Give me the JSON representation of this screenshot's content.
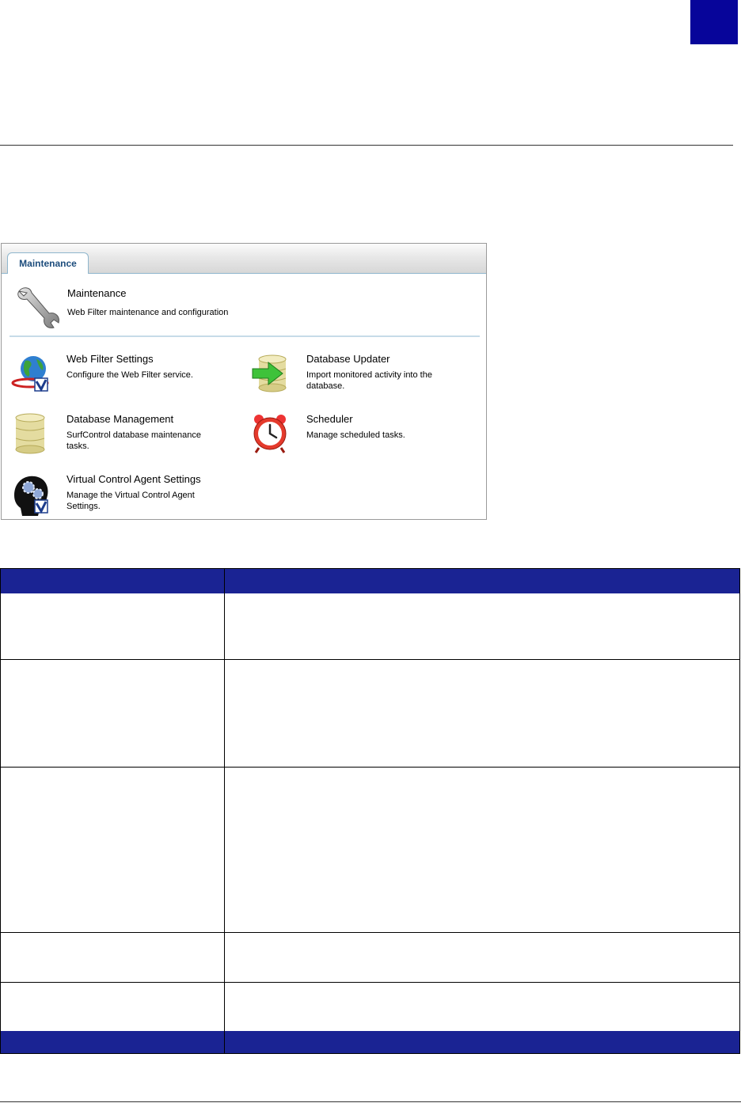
{
  "colors": {
    "accent": "#07059a",
    "table_header": "#1a2393",
    "separator": "#c6dbe8"
  },
  "panel": {
    "tab_label": "Maintenance",
    "header": {
      "icon": "wrench-icon",
      "title": "Maintenance",
      "description": "Web Filter maintenance and configuration"
    },
    "items": [
      {
        "icon": "globe-check-icon",
        "title": "Web Filter Settings",
        "description_lines": [
          "Configure the Web Filter service."
        ]
      },
      {
        "icon": "database-arrow-icon",
        "title": "Database Updater",
        "description_lines": [
          "Import monitored activity into the",
          "database."
        ]
      },
      {
        "icon": "database-icon",
        "title": "Database Management",
        "description_lines": [
          "SurfControl database maintenance",
          "tasks."
        ]
      },
      {
        "icon": "alarm-clock-icon",
        "title": "Scheduler",
        "description_lines": [
          "Manage scheduled tasks."
        ]
      },
      {
        "icon": "head-gears-icon",
        "title": "Virtual Control Agent Settings",
        "description_lines": [
          "Manage the Virtual Control Agent",
          "Settings."
        ]
      }
    ]
  }
}
